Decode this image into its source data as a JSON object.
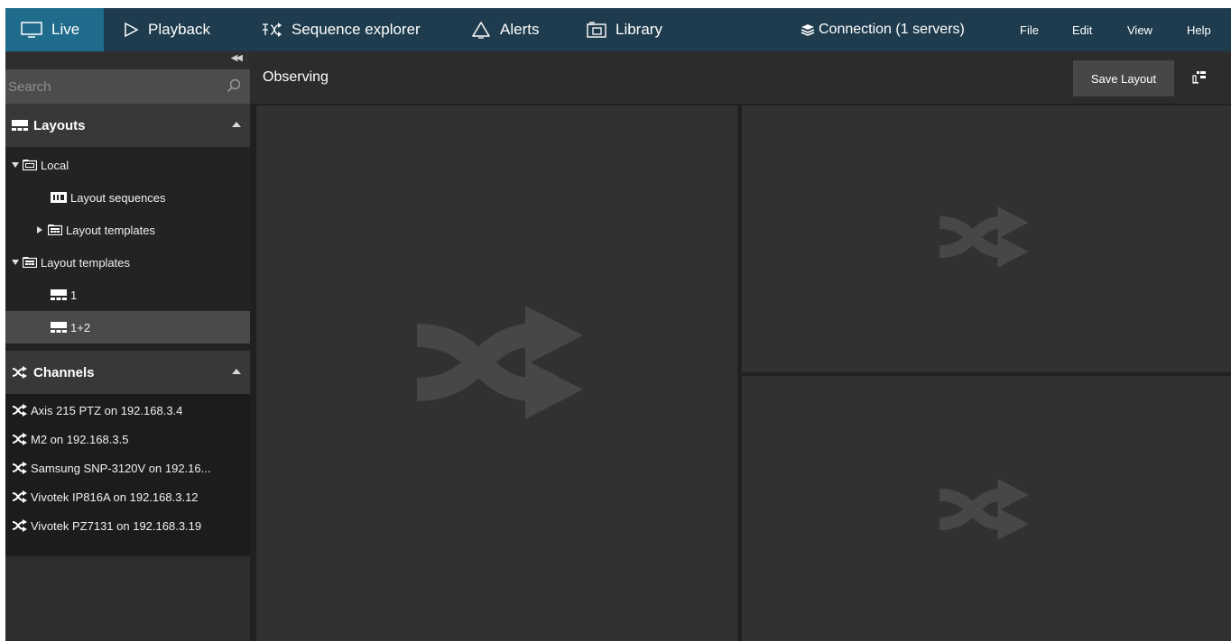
{
  "topbar": {
    "tabs": [
      {
        "label": "Live",
        "icon": "monitor-icon",
        "active": true
      },
      {
        "label": "Playback",
        "icon": "play-icon",
        "active": false
      },
      {
        "label": "Sequence explorer",
        "icon": "sequence-icon",
        "active": false
      },
      {
        "label": "Alerts",
        "icon": "bell-icon",
        "active": false
      },
      {
        "label": "Library",
        "icon": "library-icon",
        "active": false
      }
    ],
    "connection": "Connection (1 servers)",
    "menu": [
      "File",
      "Edit",
      "View",
      "Help"
    ]
  },
  "sidebar": {
    "search": {
      "placeholder": "Search",
      "value": ""
    },
    "layouts": {
      "title": "Layouts",
      "tree": [
        {
          "label": "Local",
          "expanded": true
        },
        {
          "label": "Layout sequences"
        },
        {
          "label": "Layout templates",
          "expanded": false
        },
        {
          "label": "Layout templates",
          "expanded": true
        },
        {
          "label": "1"
        },
        {
          "label": "1+2",
          "selected": true
        }
      ]
    },
    "channels": {
      "title": "Channels",
      "items": [
        {
          "label": "Axis 215 PTZ on 192.168.3.4"
        },
        {
          "label": "M2 on 192.168.3.5"
        },
        {
          "label": "Samsung SNP-3120V on 192.16..."
        },
        {
          "label": "Vivotek IP816A on 192.168.3.12"
        },
        {
          "label": "Vivotek PZ7131 on 192.168.3.19"
        }
      ]
    }
  },
  "main": {
    "title": "Observing",
    "save_label": "Save Layout"
  },
  "colors": {
    "topbar": "#1e3c4d",
    "active_tab": "#1f6b8b",
    "background": "#202020",
    "tile": "#313131"
  }
}
